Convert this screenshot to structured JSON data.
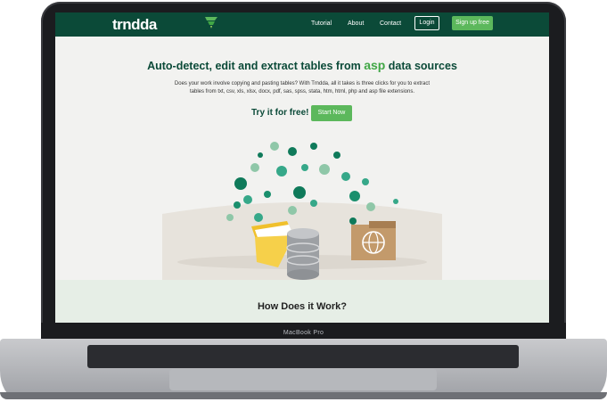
{
  "nav": {
    "logo": "trndda",
    "links": [
      "Tutorial",
      "About",
      "Contact"
    ],
    "login": "Login",
    "signup": "Sign up free"
  },
  "hero": {
    "title_pre": "Auto-detect, edit and extract tables from",
    "title_highlight": "asp",
    "title_post": "data sources",
    "description": "Does your work involve copying and pasting tables? With Trndda, all it takes is three clicks for you to extract tables from txt, csv, xls, xlsx, docx, pdf, sas, spss, stata, htm, html, php and asp file extensions.",
    "try_text": "Try it for free!",
    "start_button": "Start Now"
  },
  "section": {
    "how_title": "How Does it Work?"
  },
  "device": {
    "label": "MacBook Pro"
  },
  "colors": {
    "nav_bg": "#0b4a38",
    "accent": "#5cb85c",
    "highlight": "#41a746"
  }
}
